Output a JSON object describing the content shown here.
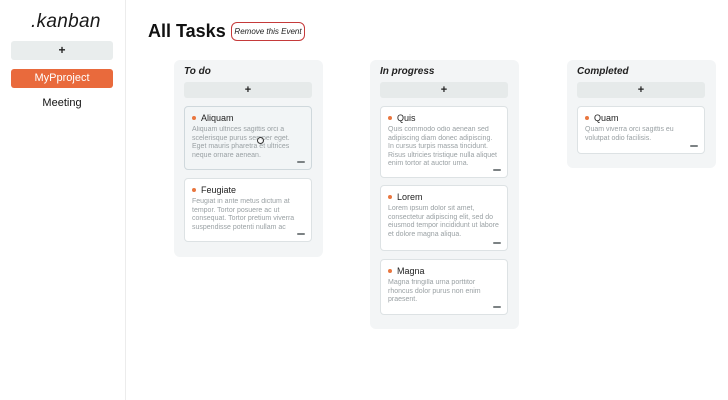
{
  "sidebar": {
    "logo": ".kanban",
    "add_label": "+",
    "projects": [
      {
        "label": "MyPproject",
        "active": true
      },
      {
        "label": "Meeting",
        "active": false
      }
    ]
  },
  "header": {
    "title": "All Tasks",
    "remove_label": "Remove this Event"
  },
  "columns": [
    {
      "title": "To do",
      "add_label": "+",
      "cards": [
        {
          "title": "Aliquam",
          "body": "Aliquam ultrices sagittis orci a scelerisque purus semper eget. Eget mauris pharetra et ultrices neque ornare aenean."
        },
        {
          "title": "Feugiate",
          "body": "Feugiat in ante metus dictum at tempor. Tortor posuere ac ut consequat. Tortor pretium viverra suspendisse potenti nullam ac tortor vitae."
        }
      ]
    },
    {
      "title": "In progress",
      "add_label": "+",
      "cards": [
        {
          "title": "Quis",
          "body": "Quis commodo odio aenean sed adipiscing diam donec adipiscing. In cursus turpis massa tincidunt. Risus ultricies tristique nulla aliquet enim tortor at auctor urna."
        },
        {
          "title": "Lorem",
          "body": "Lorem ipsum dolor sit amet, consectetur adipiscing elit, sed do eiusmod tempor incididunt ut labore et dolore magna aliqua."
        },
        {
          "title": "Magna",
          "body": "Magna fringilla urna porttitor rhoncus dolor purus non enim praesent."
        }
      ]
    },
    {
      "title": "Completed",
      "add_label": "+",
      "cards": [
        {
          "title": "Quam",
          "body": "Quam viverra orci sagittis eu volutpat odio facilisis."
        }
      ]
    }
  ],
  "colors": {
    "accent": "#e96a3c",
    "danger_border": "#c53a3a",
    "dot": "#e9763f",
    "column_bg": "#f3f5f6"
  }
}
